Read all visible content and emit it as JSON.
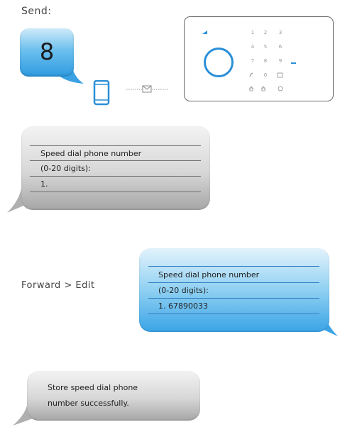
{
  "send_label": "Send:",
  "sms_key": "8",
  "keypad_keys": [
    "1",
    "2",
    "3",
    "4",
    "5",
    "6",
    "7",
    "8",
    "9",
    "0"
  ],
  "prompt_bubble": {
    "line1": "Speed dial phone number",
    "line2": "(0-20 digits):",
    "line3": "1."
  },
  "forward_label": "Forward > Edit",
  "edited_bubble": {
    "line1": "Speed dial phone number",
    "line2": "(0-20 digits):",
    "line3": "1. 67890033"
  },
  "confirm_bubble": {
    "line1": "Store speed dial phone",
    "line2": "number successfully."
  },
  "colors": {
    "accent_blue": "#2a8fd8",
    "bubble_grey": "#d7d7d7"
  },
  "icons": [
    "smartphone-icon",
    "envelope-icon",
    "alarm-panel-icon"
  ]
}
